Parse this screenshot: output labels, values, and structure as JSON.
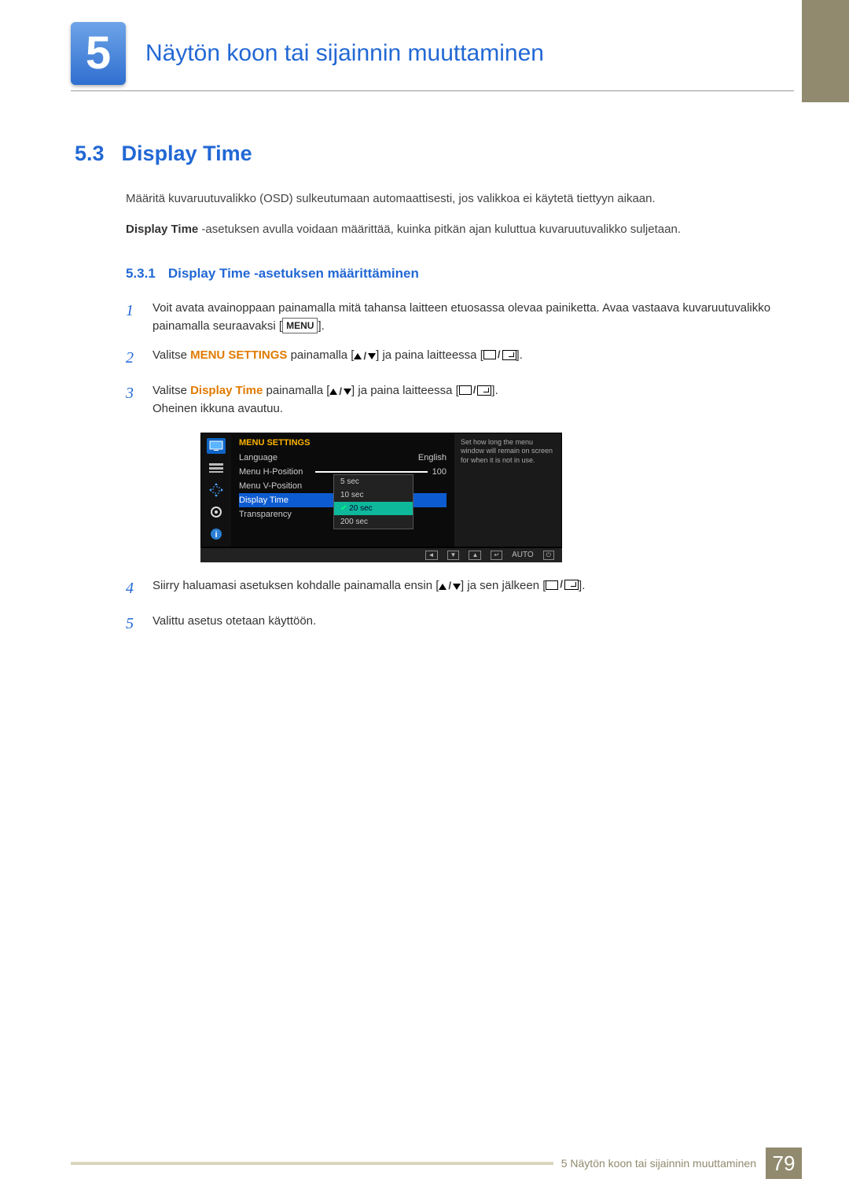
{
  "chapter": {
    "number": "5",
    "title": "Näytön koon tai sijainnin muuttaminen"
  },
  "section": {
    "number": "5.3",
    "title": "Display Time"
  },
  "intro1": "Määritä kuvaruutuvalikko (OSD) sulkeutumaan automaattisesti, jos valikkoa ei käytetä tiettyyn aikaan.",
  "intro2a": "Display Time",
  "intro2b": " -asetuksen avulla voidaan määrittää, kuinka pitkän ajan kuluttua kuvaruutuvalikko suljetaan.",
  "subsection": {
    "number": "5.3.1",
    "title": "Display Time -asetuksen määrittäminen"
  },
  "steps": {
    "s1a": "Voit avata avainoppaan painamalla mitä tahansa laitteen etuosassa olevaa painiketta. Avaa vastaava kuvaruutuvalikko painamalla seuraavaksi [",
    "s1b": "].",
    "menu_chip": "MENU",
    "s2a": "Valitse ",
    "s2b": "MENU SETTINGS",
    "s2c": " painamalla [",
    "s2d": "] ja paina laitteessa [",
    "s2e": "].",
    "s3a": "Valitse ",
    "s3b": "Display Time",
    "s3c": " painamalla [",
    "s3d": "] ja paina laitteessa [",
    "s3e": "].",
    "s3f": "Oheinen ikkuna avautuu.",
    "s4a": "Siirry haluamasi asetuksen kohdalle painamalla ensin [",
    "s4b": "] ja sen jälkeen [",
    "s4c": "].",
    "s5": "Valittu asetus otetaan käyttöön."
  },
  "osd": {
    "title": "MENU SETTINGS",
    "rows": {
      "language": "Language",
      "language_val": "English",
      "hpos": "Menu H-Position",
      "hpos_val": "100",
      "vpos": "Menu V-Position",
      "dtime": "Display Time",
      "transp": "Transparency"
    },
    "popup": {
      "o1": "5 sec",
      "o2": "10 sec",
      "o3": "20 sec",
      "o4": "200 sec"
    },
    "help": "Set how long the menu window will remain on screen for when it is not in use.",
    "footer_auto": "AUTO"
  },
  "footer": {
    "text": "5 Näytön koon tai sijainnin muuttaminen",
    "page": "79"
  }
}
